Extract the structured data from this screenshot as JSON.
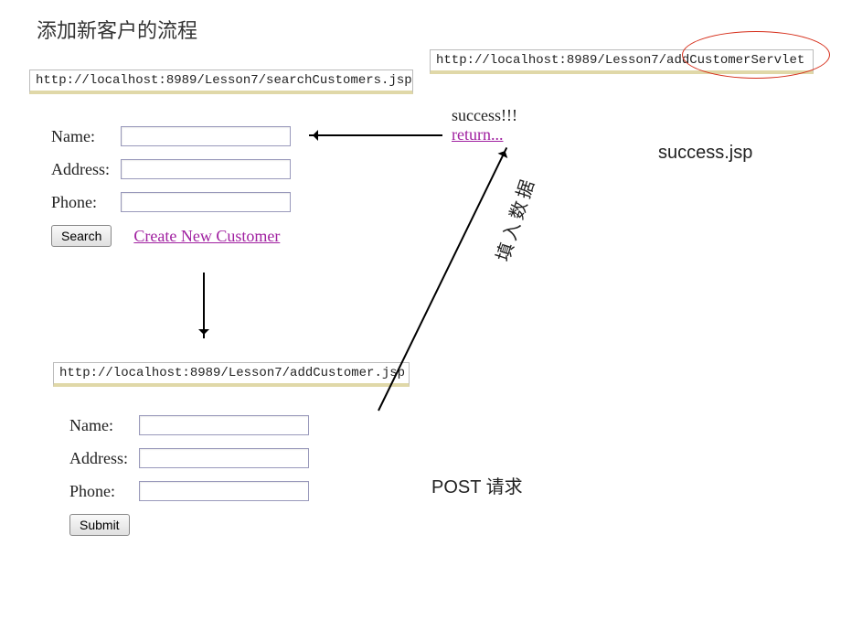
{
  "title": "添加新客户的流程",
  "urls": {
    "search_page": "http://localhost:8989/Lesson7/searchCustomers.jsp",
    "add_servlet": "http://localhost:8989/Lesson7/addCustomerServlet",
    "add_page": "http://localhost:8989/Lesson7/addCustomer.jsp"
  },
  "form": {
    "name_label": "Name:",
    "address_label": "Address:",
    "phone_label": "Phone:",
    "search_button": "Search",
    "submit_button": "Submit",
    "create_link": "Create New Customer"
  },
  "success": {
    "text": "success!!!",
    "return_link": "return..."
  },
  "labels": {
    "success_jsp": "success.jsp",
    "post_request": "POST 请求",
    "fill_data": "填入数据"
  }
}
